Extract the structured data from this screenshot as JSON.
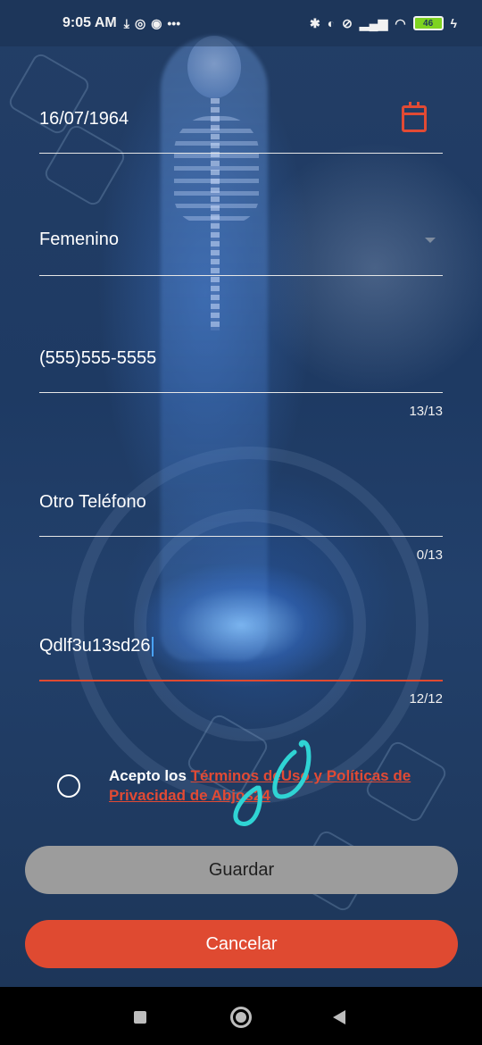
{
  "status_bar": {
    "time": "9:05 AM",
    "left_icons": [
      "download-icon",
      "whatsapp-icon",
      "app-icon",
      "more-dots-icon"
    ],
    "more_dots": "•••",
    "right_icons": [
      "bluetooth-icon",
      "toggle-icon",
      "mute-icon",
      "signal-icon",
      "wifi-icon"
    ],
    "battery_level": "46"
  },
  "form": {
    "birth_date": "16/07/1964",
    "gender": "Femenino",
    "phone": "(555)555-5555",
    "phone_counter": "13/13",
    "other_phone_placeholder": "Otro Teléfono",
    "other_phone_counter": "0/13",
    "password_value": "Qdlf3u13sd26",
    "password_counter": "12/12"
  },
  "terms": {
    "prefix": "Acepto los ",
    "link_text": "Términos deUso y Políticas de Privacidad de Abjos24"
  },
  "buttons": {
    "save_label": "Guardar",
    "cancel_label": "Cancelar"
  },
  "colors": {
    "accent": "#df4a31",
    "save_button": "#9c9c9c",
    "caret": "#4aa3ff",
    "scribble": "#2fd4d4"
  }
}
